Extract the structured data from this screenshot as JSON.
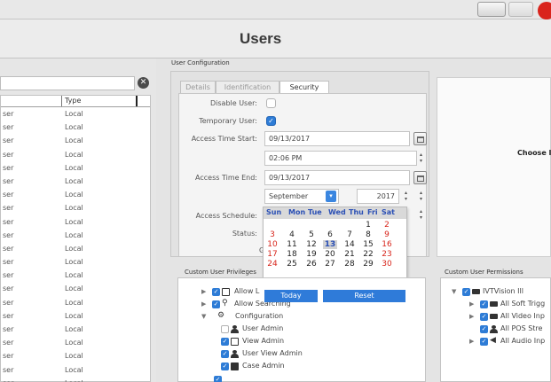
{
  "window": {
    "title": "Users"
  },
  "left": {
    "column_type": "Type",
    "rows": [
      {
        "name": "ser",
        "type": "Local"
      },
      {
        "name": "ser",
        "type": "Local"
      },
      {
        "name": "ser",
        "type": "Local"
      },
      {
        "name": "ser",
        "type": "Local"
      },
      {
        "name": "ser",
        "type": "Local"
      },
      {
        "name": "ser",
        "type": "Local"
      },
      {
        "name": "ser",
        "type": "Local"
      },
      {
        "name": "ser",
        "type": "Local"
      },
      {
        "name": "ser",
        "type": "Local"
      },
      {
        "name": "ser",
        "type": "Local"
      },
      {
        "name": "ser",
        "type": "Local"
      },
      {
        "name": "ser",
        "type": "Local"
      },
      {
        "name": "ser",
        "type": "Local"
      },
      {
        "name": "ser",
        "type": "Local"
      },
      {
        "name": "ser",
        "type": "Local"
      },
      {
        "name": "ser",
        "type": "Local"
      },
      {
        "name": "ser",
        "type": "Local"
      },
      {
        "name": "ser",
        "type": "Local"
      },
      {
        "name": "ser",
        "type": "Local"
      },
      {
        "name": "ser",
        "type": "Local"
      },
      {
        "name": "ser",
        "type": "Local"
      }
    ]
  },
  "config": {
    "section_label": "User Configuration",
    "tabs": [
      "Details",
      "Identification",
      "Security"
    ],
    "active_tab": "Security",
    "disable_user_label": "Disable User:",
    "temporary_user_label": "Temporary User:",
    "temporary_user_checked": true,
    "access_start_label": "Access Time Start:",
    "access_start_date": "09/13/2017",
    "access_start_time": "02:06 PM",
    "access_end_label": "Access Time End:",
    "access_end_date": "09/13/2017",
    "month": "September",
    "year": "2017",
    "schedule_label": "Access Schedule:",
    "status_label": "Status:",
    "g_fragment": "G"
  },
  "calendar": {
    "weekdays": [
      "Sun",
      "Mon",
      "Tue",
      "Wed",
      "Thu",
      "Fri",
      "Sat"
    ],
    "weeks": [
      [
        "",
        "",
        "",
        "",
        "",
        "1",
        "2"
      ],
      [
        "3",
        "4",
        "5",
        "6",
        "7",
        "8",
        "9"
      ],
      [
        "10",
        "11",
        "12",
        "13",
        "14",
        "15",
        "16"
      ],
      [
        "17",
        "18",
        "19",
        "20",
        "21",
        "22",
        "23"
      ],
      [
        "24",
        "25",
        "26",
        "27",
        "28",
        "29",
        "30"
      ]
    ],
    "selected_day": "13",
    "today_label": "Today",
    "reset_label": "Reset"
  },
  "privileges": {
    "section_label": "Custom User Privileges",
    "items": [
      {
        "label": "Allow L"
      },
      {
        "label": "Allow Searching"
      },
      {
        "label": "Configuration"
      },
      {
        "label": "User Admin"
      },
      {
        "label": "View Admin"
      },
      {
        "label": "User View Admin"
      },
      {
        "label": "Case Admin"
      }
    ]
  },
  "right": {
    "choose_label": "Choose Ite",
    "permissions_label": "Custom User Permissions",
    "permissions": [
      {
        "label": "IVTVision Ill"
      },
      {
        "label": "All Soft Trigg"
      },
      {
        "label": "All Video Inp"
      },
      {
        "label": "All POS Stre"
      },
      {
        "label": "All Audio Inp"
      }
    ]
  },
  "colors": {
    "accent": "#2e7cd6",
    "weekend": "#d8261c",
    "weekday_header": "#2a4fb5"
  }
}
